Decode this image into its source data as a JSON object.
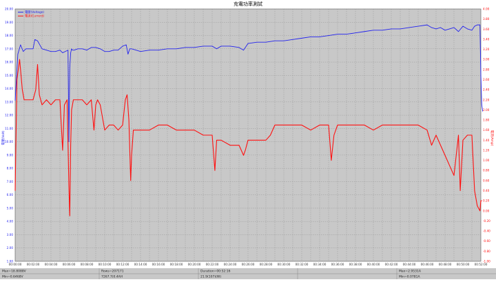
{
  "colors": {
    "background": "#ffffff",
    "plot_bg": "#c8c8c8",
    "grid": "#8c8c8c",
    "voltage": "#2222ee",
    "current": "#ff1010",
    "left_axis": "#2222ee",
    "right_axis": "#ff1010",
    "info_bg": "#c8c8c8",
    "info_line": "#777777"
  },
  "chart_data": {
    "type": "line",
    "title": "充電功率測試",
    "xlabel": "",
    "x_tick_labels": [
      "00:00:00",
      "00:02:00",
      "00:04:00",
      "00:06:00",
      "00:08:00",
      "00:10:00",
      "00:12:00",
      "00:14:00",
      "00:16:00",
      "00:18:00",
      "00:20:00",
      "00:22:00",
      "00:24:00",
      "00:26:00",
      "00:28:00",
      "00:30:00",
      "00:32:00",
      "00:34:00",
      "00:36:00",
      "00:38:00",
      "00:40:00",
      "00:42:00",
      "00:44:00",
      "00:46:00",
      "00:48:00",
      "00:50:00",
      "00:52:00"
    ],
    "xlim_minutes": [
      0,
      52
    ],
    "left_axis": {
      "label": "電壓(Volt)",
      "ylim": [
        1.0,
        20.0
      ],
      "ticks": [
        "1.00",
        "2.00",
        "3.00",
        "4.00",
        "5.00",
        "6.00",
        "7.00",
        "8.00",
        "9.00",
        "10.00",
        "11.00",
        "12.00",
        "13.00",
        "14.00",
        "15.00",
        "16.00",
        "17.00",
        "18.00",
        "19.00",
        "20.00"
      ]
    },
    "right_axis": {
      "label": "電流(Amp)",
      "ylim": [
        -1.0,
        4.0
      ],
      "ticks": [
        "-1.00",
        "-0.80",
        "-0.60",
        "-0.40",
        "-0.20",
        "0.00",
        "0.20",
        "0.40",
        "0.60",
        "0.80",
        "1.00",
        "1.20",
        "1.40",
        "1.60",
        "1.80",
        "2.00",
        "2.20",
        "2.40",
        "2.60",
        "2.80",
        "3.00",
        "3.20",
        "3.40",
        "3.60",
        "3.80",
        "4.00"
      ]
    },
    "grid": true,
    "legend": {
      "position": "top-left",
      "entries": [
        "電壓(Voltage)",
        "電流(Current)"
      ]
    },
    "series": [
      {
        "name": "電壓(Voltage)",
        "axis": "left",
        "x_minutes": [
          0,
          0.3,
          0.6,
          0.9,
          1.2,
          1.5,
          2.0,
          2.2,
          2.5,
          3.0,
          3.5,
          4.0,
          4.5,
          5.0,
          5.3,
          5.6,
          5.9,
          6.0,
          6.1,
          6.2,
          6.3,
          6.4,
          6.6,
          7.0,
          7.5,
          8.0,
          8.5,
          9.0,
          9.5,
          10.0,
          10.5,
          11.0,
          11.5,
          12.0,
          12.4,
          12.6,
          12.8,
          13.0,
          13.5,
          14.0,
          15.0,
          16.0,
          17.0,
          18.0,
          19.0,
          20.0,
          21.0,
          22.0,
          22.5,
          23.0,
          24.0,
          25.0,
          25.5,
          26.0,
          27.0,
          28.0,
          29.0,
          30.0,
          31.0,
          32.0,
          33.0,
          34.0,
          35.0,
          36.0,
          37.0,
          38.0,
          39.0,
          40.0,
          41.0,
          42.0,
          43.0,
          44.0,
          45.0,
          46.0,
          46.5,
          47.0,
          47.5,
          48.0,
          48.5,
          49.0,
          49.5,
          50.0,
          50.5,
          51.0,
          51.3,
          51.6,
          51.9,
          52.0,
          52.1,
          52.2
        ],
        "y": [
          13.1,
          16.6,
          17.3,
          16.8,
          17.0,
          17.0,
          17.0,
          17.7,
          17.6,
          17.0,
          16.9,
          16.8,
          16.8,
          16.9,
          16.7,
          16.8,
          16.9,
          10.0,
          15.6,
          16.7,
          17.0,
          16.9,
          16.9,
          17.0,
          17.0,
          16.9,
          17.1,
          17.1,
          17.0,
          16.8,
          16.8,
          16.9,
          16.9,
          17.2,
          17.3,
          16.6,
          17.0,
          17.0,
          16.9,
          16.8,
          16.9,
          16.9,
          17.0,
          17.0,
          17.1,
          17.1,
          17.2,
          17.2,
          17.0,
          17.2,
          17.2,
          17.1,
          16.9,
          17.4,
          17.5,
          17.5,
          17.6,
          17.6,
          17.7,
          17.8,
          17.9,
          17.9,
          18.0,
          18.1,
          18.1,
          18.2,
          18.3,
          18.4,
          18.4,
          18.5,
          18.5,
          18.6,
          18.7,
          18.8,
          18.6,
          18.5,
          18.6,
          18.4,
          18.5,
          18.6,
          18.3,
          18.7,
          18.5,
          18.4,
          18.7,
          18.8,
          18.8,
          15.0,
          12.8,
          12.3
        ]
      },
      {
        "name": "電流(Current)",
        "axis": "right",
        "x_minutes": [
          0,
          0.2,
          0.5,
          0.8,
          1.0,
          1.2,
          1.6,
          2.0,
          2.3,
          2.5,
          2.7,
          3.0,
          3.5,
          4.0,
          4.5,
          5.0,
          5.3,
          5.5,
          5.8,
          6.0,
          6.1,
          6.2,
          6.3,
          6.5,
          7.0,
          7.5,
          8.0,
          8.5,
          8.8,
          9.0,
          9.2,
          9.5,
          10.0,
          10.5,
          11.0,
          11.5,
          12.0,
          12.3,
          12.5,
          12.7,
          12.9,
          13.0,
          13.2,
          13.5,
          14.0,
          15.0,
          16.0,
          17.0,
          18.0,
          19.0,
          20.0,
          21.0,
          22.0,
          22.3,
          22.5,
          23.0,
          24.0,
          25.0,
          25.5,
          25.7,
          26.0,
          27.0,
          28.0,
          28.5,
          29.0,
          30.0,
          31.0,
          32.0,
          33.0,
          34.0,
          35.0,
          35.3,
          35.6,
          36.0,
          37.0,
          38.0,
          39.0,
          40.0,
          41.0,
          42.0,
          43.0,
          44.0,
          45.0,
          46.0,
          46.5,
          47.0,
          47.5,
          48.0,
          48.5,
          49.0,
          49.5,
          49.7,
          50.0,
          50.5,
          51.0,
          51.3,
          51.6,
          51.9,
          52.0,
          52.1
        ],
        "y": [
          0.4,
          2.6,
          3.0,
          2.4,
          2.2,
          2.2,
          2.2,
          2.2,
          2.4,
          2.9,
          2.3,
          2.1,
          2.2,
          2.1,
          2.2,
          2.2,
          1.2,
          2.1,
          2.2,
          0.5,
          -0.1,
          1.3,
          2.0,
          2.2,
          2.2,
          2.2,
          2.1,
          2.2,
          1.6,
          2.1,
          2.2,
          2.1,
          1.6,
          1.7,
          1.7,
          1.6,
          1.7,
          2.2,
          2.3,
          1.8,
          0.6,
          1.1,
          1.6,
          1.6,
          1.6,
          1.6,
          1.7,
          1.7,
          1.6,
          1.6,
          1.6,
          1.5,
          1.5,
          0.8,
          1.4,
          1.4,
          1.3,
          1.3,
          1.1,
          1.2,
          1.4,
          1.4,
          1.4,
          1.5,
          1.7,
          1.7,
          1.7,
          1.7,
          1.6,
          1.7,
          1.7,
          1.0,
          1.5,
          1.7,
          1.7,
          1.7,
          1.7,
          1.6,
          1.7,
          1.7,
          1.7,
          1.7,
          1.7,
          1.6,
          1.3,
          1.5,
          1.3,
          1.1,
          0.9,
          0.7,
          1.5,
          0.4,
          1.4,
          1.5,
          1.5,
          0.4,
          0.1,
          0.0,
          0.2,
          0.2
        ]
      }
    ]
  },
  "info_bar": {
    "cells": [
      [
        "Max=18.8088V",
        "Min=0.6468V"
      ],
      [
        "Rows=207171",
        "7267.7(0.4AH"
      ],
      [
        "Duration=00:52:16",
        "21.9(107)(W)"
      ],
      [
        "",
        ""
      ],
      [
        "Max=2.9531A",
        "Min=0.0781A"
      ]
    ]
  }
}
